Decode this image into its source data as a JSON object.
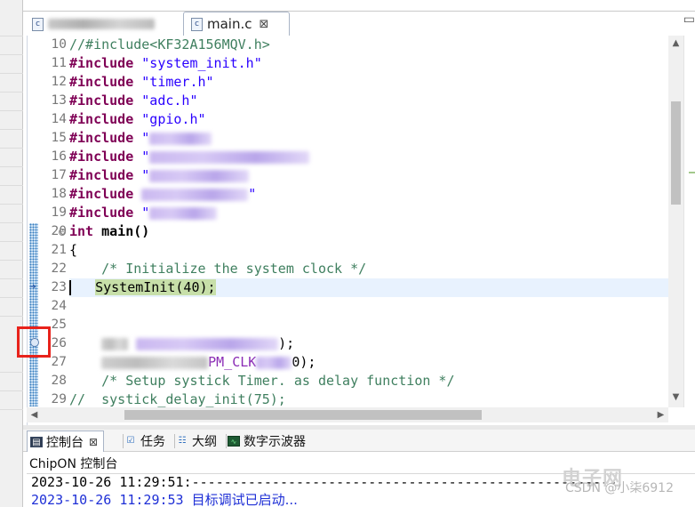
{
  "tabs": {
    "inactive_label": "",
    "active_label": "main.c",
    "active_close": "⊠",
    "file_icon_glyph": "c"
  },
  "editor": {
    "line_numbers": [
      "10",
      "11",
      "12",
      "13",
      "14",
      "15",
      "16",
      "17",
      "18",
      "19",
      "20",
      "21",
      "22",
      "23",
      "24",
      "25",
      "26",
      "27",
      "28",
      "29"
    ],
    "lines": {
      "l10_comment": "//#include<KF32A156MQV.h>",
      "include_kw": "#include",
      "l11_str": "\"system_init.h\"",
      "l12_str": "\"timer.h\"",
      "l13_str": "\"adc.h\"",
      "l14_str": "\"gpio.h\"",
      "l15_str": "\"",
      "l16_str": "\"",
      "l17_str": "\"",
      "l18_str": "\"",
      "l19_str": "\"",
      "l20_kw": "int",
      "l20_fn": " main()",
      "l21": "{",
      "l22_comment": "    /* Initialize the system clock */",
      "l23_call": "SystemInit(40);",
      "l26_tail": ");",
      "l27_macro": "PM_CLK",
      "l27_tail": "0);",
      "l28_comment": "    /* Setup systick Timer. as delay function */",
      "l29_comment": "//  systick_delay_init(75);"
    },
    "current_line": "23",
    "breakpoint_line": "26"
  },
  "console_panel": {
    "tabs": [
      {
        "label": "控制台",
        "icon": "console-icon"
      },
      {
        "label": "任务",
        "icon": "tasks-icon"
      },
      {
        "label": "大纲",
        "icon": "outline-icon"
      },
      {
        "label": "数字示波器",
        "icon": "oscilloscope-icon"
      }
    ],
    "close_glyph": "⊠",
    "title": "ChipON 控制台",
    "line1": "2023-10-26 11:29:51:-----------------------------------------------------",
    "line2_time": "2023-10-26 11:29:53 ",
    "line2_msg": "目标调试已启动..."
  },
  "watermark": {
    "text": "CSDN @小柒6912",
    "logo": "电子网"
  },
  "colors": {
    "keyword": "#7f0055",
    "string": "#2a00ff",
    "comment": "#3f7f5f",
    "current_line_bg": "#e8f2fe",
    "highlight_bg": "#c7dfa9",
    "annotation_red": "#e8221b",
    "console_info": "#1e2fd6"
  }
}
